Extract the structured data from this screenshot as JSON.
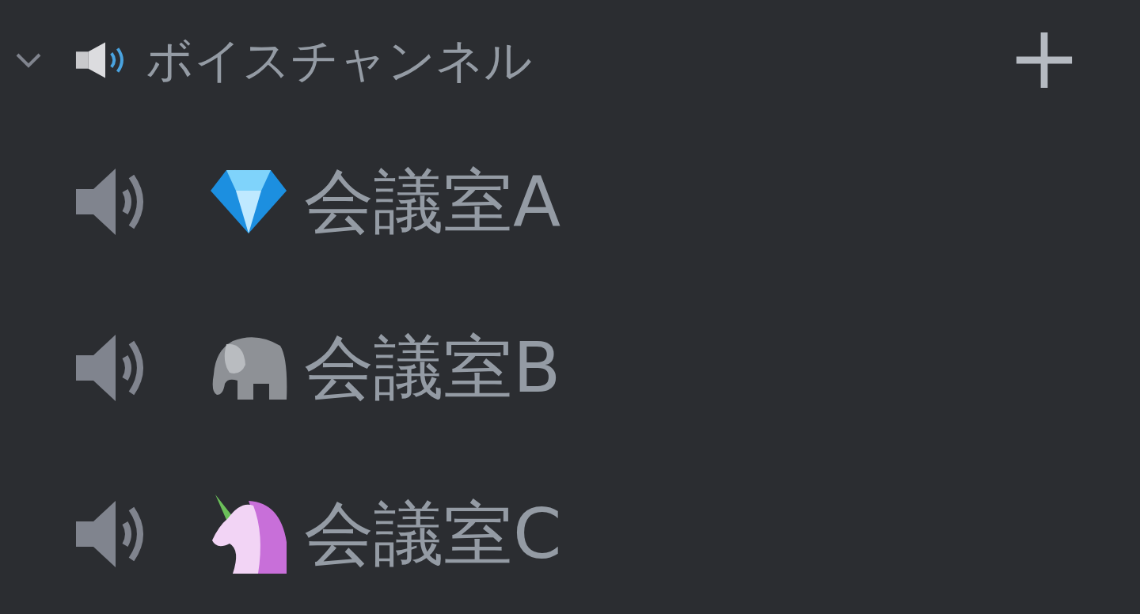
{
  "category": {
    "name": "ボイスチャンネル",
    "expanded": true
  },
  "channels": [
    {
      "name": "会議室A",
      "kind": "diamond"
    },
    {
      "name": "会議室B",
      "kind": "elephant"
    },
    {
      "name": "会議室C",
      "kind": "unicorn"
    }
  ]
}
